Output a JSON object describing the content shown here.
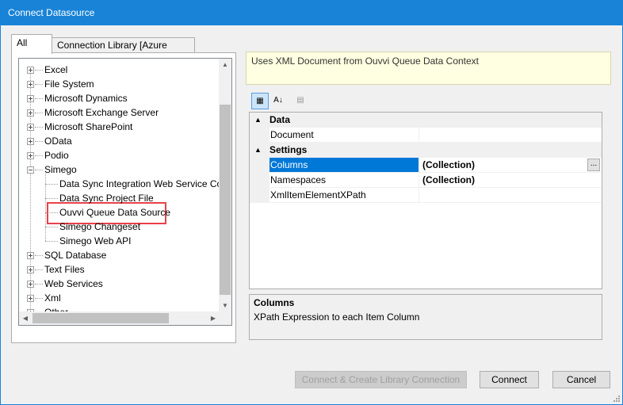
{
  "window": {
    "title": "Connect Datasource"
  },
  "tabs": [
    {
      "label": "All",
      "active": true
    },
    {
      "label": "Connection Library [Azure (Dev)]",
      "active": false
    }
  ],
  "tree": {
    "items": [
      {
        "label": "Excel",
        "level": 0,
        "expander": "plus"
      },
      {
        "label": "File System",
        "level": 0,
        "expander": "plus"
      },
      {
        "label": "Microsoft Dynamics",
        "level": 0,
        "expander": "plus"
      },
      {
        "label": "Microsoft Exchange Server",
        "level": 0,
        "expander": "plus"
      },
      {
        "label": "Microsoft SharePoint",
        "level": 0,
        "expander": "plus"
      },
      {
        "label": "OData",
        "level": 0,
        "expander": "plus"
      },
      {
        "label": "Podio",
        "level": 0,
        "expander": "plus"
      },
      {
        "label": "Simego",
        "level": 0,
        "expander": "minus"
      },
      {
        "label": "Data Sync Integration Web Service Conr",
        "level": 1
      },
      {
        "label": "Data Sync Project File",
        "level": 1
      },
      {
        "label": "Ouvvi Queue Data Source",
        "level": 1,
        "highlighted": true
      },
      {
        "label": "Simego Changeset",
        "level": 1
      },
      {
        "label": "Simego Web API",
        "level": 1
      },
      {
        "label": "SQL Database",
        "level": 0,
        "expander": "plus"
      },
      {
        "label": "Text Files",
        "level": 0,
        "expander": "plus"
      },
      {
        "label": "Web Services",
        "level": 0,
        "expander": "plus"
      },
      {
        "label": "Xml",
        "level": 0,
        "expander": "plus"
      },
      {
        "label": "Other",
        "level": 0,
        "expander": "plus"
      }
    ]
  },
  "description": "Uses XML Document from Ouvvi Queue Data Context",
  "toolbar": {
    "categorized_glyph": "▦",
    "alphabetical_glyph": "A↓",
    "pages_glyph": "▤"
  },
  "propertyGrid": {
    "categories": [
      {
        "name": "Data",
        "chevron": "▲",
        "rows": [
          {
            "name": "Document",
            "value": ""
          }
        ]
      },
      {
        "name": "Settings",
        "chevron": "▲",
        "rows": [
          {
            "name": "Columns",
            "value": "(Collection)",
            "selected": true,
            "ellipsis": "..."
          },
          {
            "name": "Namespaces",
            "value": "(Collection)"
          },
          {
            "name": "XmlItemElementXPath",
            "value": ""
          }
        ]
      }
    ],
    "help": {
      "title": "Columns",
      "text": "XPath Expression to each Item Column"
    }
  },
  "buttons": {
    "connect_create": "Connect & Create Library Connection",
    "connect": "Connect",
    "cancel": "Cancel"
  }
}
